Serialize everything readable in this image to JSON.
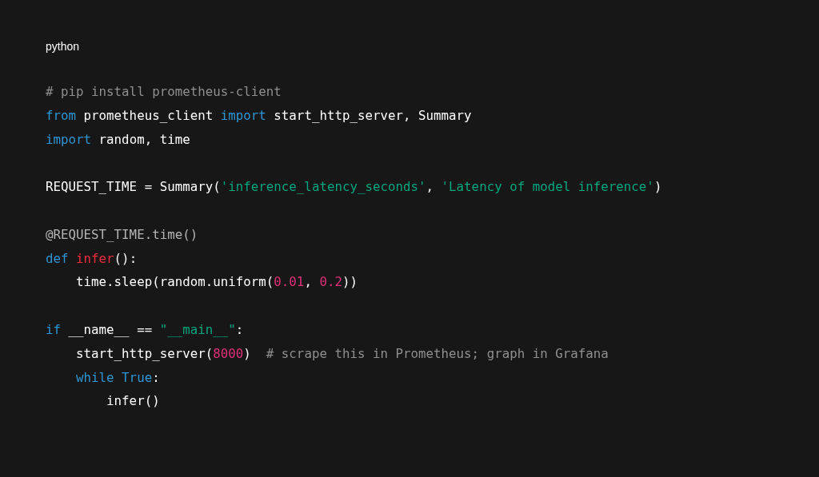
{
  "code_block": {
    "language": "python",
    "lines": [
      {
        "kind": "code",
        "tokens": [
          {
            "kind": "comment",
            "text": "# pip install prometheus-client"
          }
        ]
      },
      {
        "kind": "code",
        "tokens": [
          {
            "kind": "keyword",
            "text": "from"
          },
          {
            "kind": "plain",
            "text": " prometheus_client "
          },
          {
            "kind": "keyword",
            "text": "import"
          },
          {
            "kind": "plain",
            "text": " start_http_server, Summary"
          }
        ]
      },
      {
        "kind": "code",
        "tokens": [
          {
            "kind": "keyword",
            "text": "import"
          },
          {
            "kind": "plain",
            "text": " random, time"
          }
        ]
      },
      {
        "kind": "blank"
      },
      {
        "kind": "code",
        "tokens": [
          {
            "kind": "plain",
            "text": "REQUEST_TIME = Summary("
          },
          {
            "kind": "string",
            "text": "'inference_latency_seconds'"
          },
          {
            "kind": "plain",
            "text": ", "
          },
          {
            "kind": "string",
            "text": "'Latency of model inference'"
          },
          {
            "kind": "plain",
            "text": ")"
          }
        ]
      },
      {
        "kind": "blank"
      },
      {
        "kind": "code",
        "tokens": [
          {
            "kind": "decorator",
            "text": "@REQUEST_TIME.time()"
          }
        ]
      },
      {
        "kind": "code",
        "tokens": [
          {
            "kind": "keyword",
            "text": "def "
          },
          {
            "kind": "function",
            "text": "infer"
          },
          {
            "kind": "plain",
            "text": "():"
          }
        ]
      },
      {
        "kind": "code",
        "tokens": [
          {
            "kind": "plain",
            "text": "    time.sleep(random.uniform("
          },
          {
            "kind": "number",
            "text": "0.01"
          },
          {
            "kind": "plain",
            "text": ", "
          },
          {
            "kind": "number",
            "text": "0.2"
          },
          {
            "kind": "plain",
            "text": "))"
          }
        ]
      },
      {
        "kind": "blank"
      },
      {
        "kind": "code",
        "tokens": [
          {
            "kind": "keyword",
            "text": "if"
          },
          {
            "kind": "plain",
            "text": " __name__ == "
          },
          {
            "kind": "string",
            "text": "\"__main__\""
          },
          {
            "kind": "plain",
            "text": ":"
          }
        ]
      },
      {
        "kind": "code",
        "tokens": [
          {
            "kind": "plain",
            "text": "    start_http_server("
          },
          {
            "kind": "number",
            "text": "8000"
          },
          {
            "kind": "plain",
            "text": ")  "
          },
          {
            "kind": "comment",
            "text": "# scrape this in Prometheus; graph in Grafana"
          }
        ]
      },
      {
        "kind": "code",
        "tokens": [
          {
            "kind": "keyword",
            "text": "    while True"
          },
          {
            "kind": "plain",
            "text": ":"
          }
        ]
      },
      {
        "kind": "code",
        "tokens": [
          {
            "kind": "plain",
            "text": "        infer()"
          }
        ]
      }
    ]
  }
}
